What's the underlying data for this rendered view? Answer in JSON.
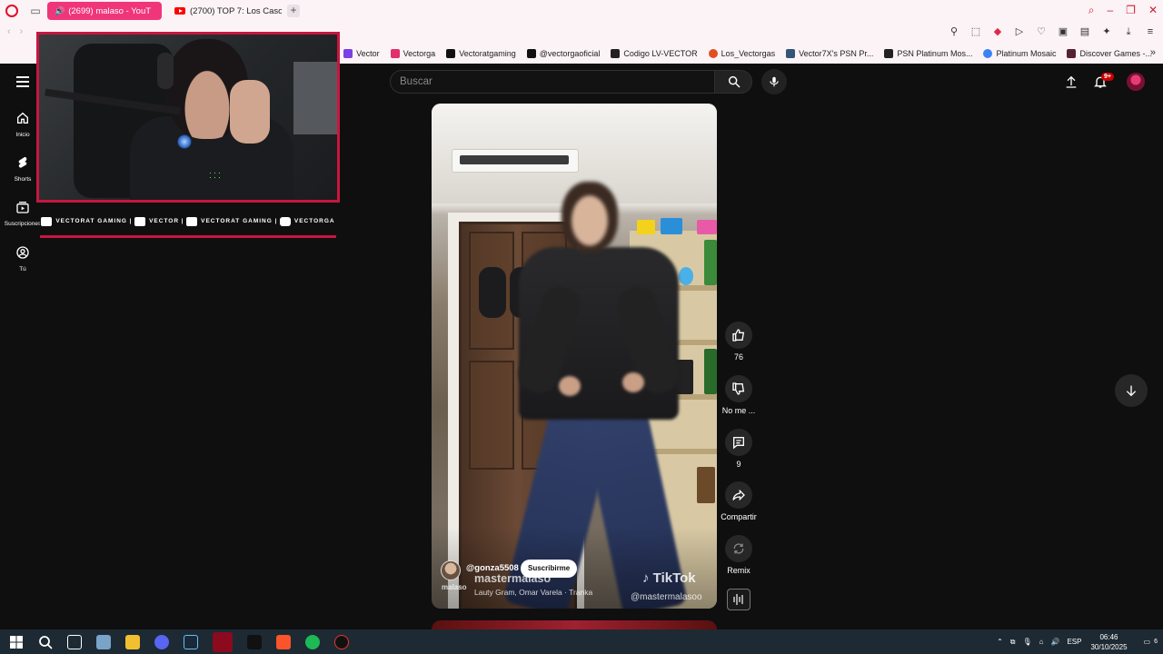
{
  "browser": {
    "tabs": [
      {
        "title": "(2699) malaso - YouT",
        "active": true,
        "audio": true
      },
      {
        "title": "(2700) TOP 7: Los Casos",
        "active": false,
        "audio": false
      }
    ],
    "bookmarks": [
      {
        "label": "Vector",
        "color": "#7b3fe4"
      },
      {
        "label": "Vectorga",
        "color": "#e1306c"
      },
      {
        "label": "Vectoratgaming",
        "color": "#111111"
      },
      {
        "label": "@vectorgaoficial",
        "color": "#111111"
      },
      {
        "label": "Codigo LV-VECTOR",
        "color": "#222222"
      },
      {
        "label": "Los_Vectorgas",
        "color": "#e05020"
      },
      {
        "label": "Vector7X's PSN Pr...",
        "color": "#335577"
      },
      {
        "label": "PSN Platinum Mos...",
        "color": "#222222"
      },
      {
        "label": "Platinum Mosaic",
        "color": "#3b82f6"
      },
      {
        "label": "Discover Games -...",
        "color": "#552233"
      }
    ]
  },
  "youtube": {
    "sidebar": [
      {
        "label": "Inicio",
        "icon": "home-icon"
      },
      {
        "label": "Shorts",
        "icon": "shorts-icon"
      },
      {
        "label": "Suscripciones",
        "icon": "subscriptions-icon"
      },
      {
        "label": "Tú",
        "icon": "user-icon"
      }
    ],
    "search_placeholder": "Buscar",
    "notifications_badge": "9+",
    "short": {
      "channel": "@gonza5508",
      "subscribe_label": "Suscribirme",
      "watermark_user": "mastermalaso",
      "watermark_sub": "Lauty Gram, Omar Varela · Tranka",
      "watermark_left": "malaso",
      "tiktok_brand": "TikTok",
      "tiktok_handle": "@mastermalasoo"
    },
    "actions": {
      "likes": "76",
      "dislike_label": "No me ...",
      "comments": "9",
      "share_label": "Compartir",
      "remix_label": "Remix"
    }
  },
  "overlay": {
    "socials": [
      {
        "label": "VECTORAT GAMING"
      },
      {
        "label": "VECTOR"
      },
      {
        "label": "VECTORAT GAMING"
      },
      {
        "label": "VECTORGA"
      }
    ]
  },
  "taskbar": {
    "language": "ESP",
    "time": "06:46",
    "date": "30/10/2025",
    "notification_count": "6"
  }
}
